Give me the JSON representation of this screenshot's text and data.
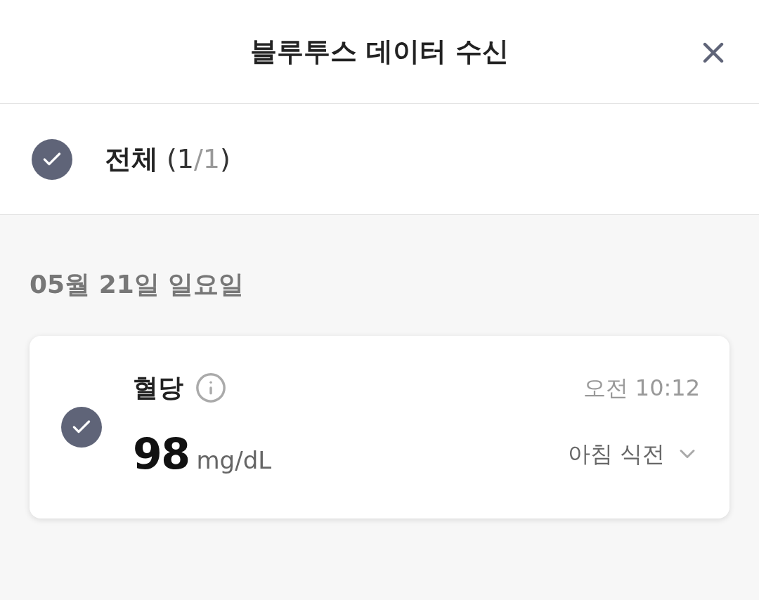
{
  "header": {
    "title": "블루투스 데이터 수신"
  },
  "select_all": {
    "checked": true,
    "label": "전체",
    "count_parts": [
      {
        "text": "(1",
        "muted": false
      },
      {
        "text": "/1",
        "muted": true
      },
      {
        "text": ")",
        "muted": false
      }
    ]
  },
  "groups": [
    {
      "date": "05월 21일 일요일",
      "records": [
        {
          "checked": true,
          "name": "혈당",
          "time": "오전 10:12",
          "value": "98",
          "unit": "mg/dL",
          "meal": "아침 식전"
        }
      ]
    }
  ]
}
